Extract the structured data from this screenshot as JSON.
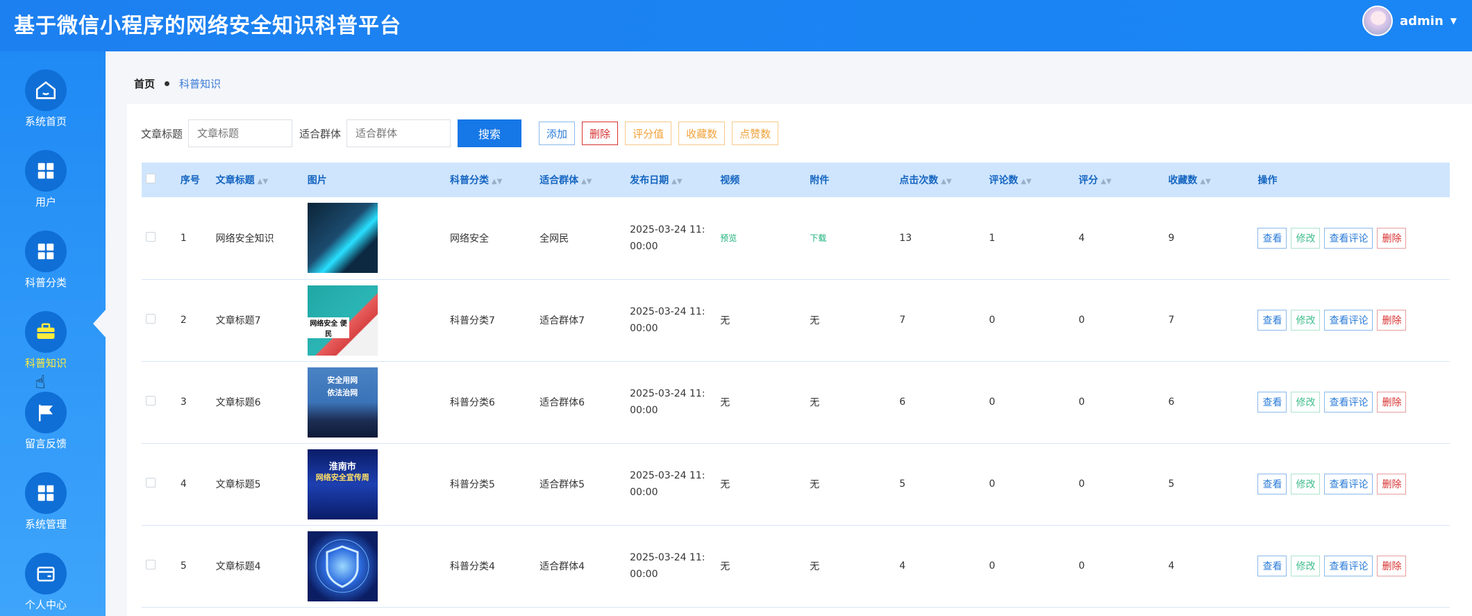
{
  "app_title": "基于微信小程序的网络安全知识科普平台",
  "user": {
    "name": "admin",
    "caret": "▼"
  },
  "sidebar": {
    "items": [
      {
        "label": "系统首页",
        "icon": "home-icon"
      },
      {
        "label": "用户",
        "icon": "grid-icon"
      },
      {
        "label": "科普分类",
        "icon": "grid-icon"
      },
      {
        "label": "科普知识",
        "icon": "briefcase-icon",
        "active": true
      },
      {
        "label": "留言反馈",
        "icon": "flag-icon"
      },
      {
        "label": "系统管理",
        "icon": "grid-icon"
      },
      {
        "label": "个人中心",
        "icon": "wallet-icon"
      }
    ]
  },
  "breadcrumb": {
    "home": "首页",
    "current": "科普知识"
  },
  "search": {
    "title_label": "文章标题",
    "title_placeholder": "文章标题",
    "group_label": "适合群体",
    "group_placeholder": "适合群体",
    "search_button": "搜索"
  },
  "toolbar": {
    "add": "添加",
    "delete": "删除",
    "rating": "评分值",
    "favorites": "收藏数",
    "likes": "点赞数"
  },
  "table": {
    "headers": [
      "序号",
      "文章标题",
      "图片",
      "科普分类",
      "适合群体",
      "发布日期",
      "视频",
      "附件",
      "点击次数",
      "评论数",
      "评分",
      "收藏数",
      "操作"
    ],
    "sortable_marker": "▲▼",
    "rows": [
      {
        "index": "1",
        "title": "网络安全知识",
        "category": "网络安全",
        "group": "全网民",
        "date": "2025-03-24 11:00:00",
        "video": "预览",
        "attachment": "下载",
        "clicks": "13",
        "comments": "1",
        "rating": "4",
        "favorites": "9"
      },
      {
        "index": "2",
        "title": "文章标题7",
        "category": "科普分类7",
        "group": "适合群体7",
        "date": "2025-03-24 11:00:00",
        "video": "无",
        "attachment": "无",
        "clicks": "7",
        "comments": "0",
        "rating": "0",
        "favorites": "7"
      },
      {
        "index": "3",
        "title": "文章标题6",
        "category": "科普分类6",
        "group": "适合群体6",
        "date": "2025-03-24 11:00:00",
        "video": "无",
        "attachment": "无",
        "clicks": "6",
        "comments": "0",
        "rating": "0",
        "favorites": "6"
      },
      {
        "index": "4",
        "title": "文章标题5",
        "category": "科普分类5",
        "group": "适合群体5",
        "date": "2025-03-24 11:00:00",
        "video": "无",
        "attachment": "无",
        "clicks": "5",
        "comments": "0",
        "rating": "0",
        "favorites": "5"
      },
      {
        "index": "5",
        "title": "文章标题4",
        "category": "科普分类4",
        "group": "适合群体4",
        "date": "2025-03-24 11:00:00",
        "video": "无",
        "attachment": "无",
        "clicks": "4",
        "comments": "0",
        "rating": "0",
        "favorites": "4"
      }
    ],
    "thumb_text": {
      "row2": "网络安全 便民",
      "row3_line1": "安全用网",
      "row3_line2": "依法治网",
      "row4_line1": "淮南市",
      "row4_line2": "网络安全宣传周"
    },
    "actions": {
      "view": "查看",
      "edit": "修改",
      "comments": "查看评论",
      "delete": "删除"
    }
  },
  "colors": {
    "header": "#1a86f5",
    "sidebar": "#2a93f7",
    "active_label": "#ffeb3b",
    "table_header_bg": "#cfe5fd"
  }
}
